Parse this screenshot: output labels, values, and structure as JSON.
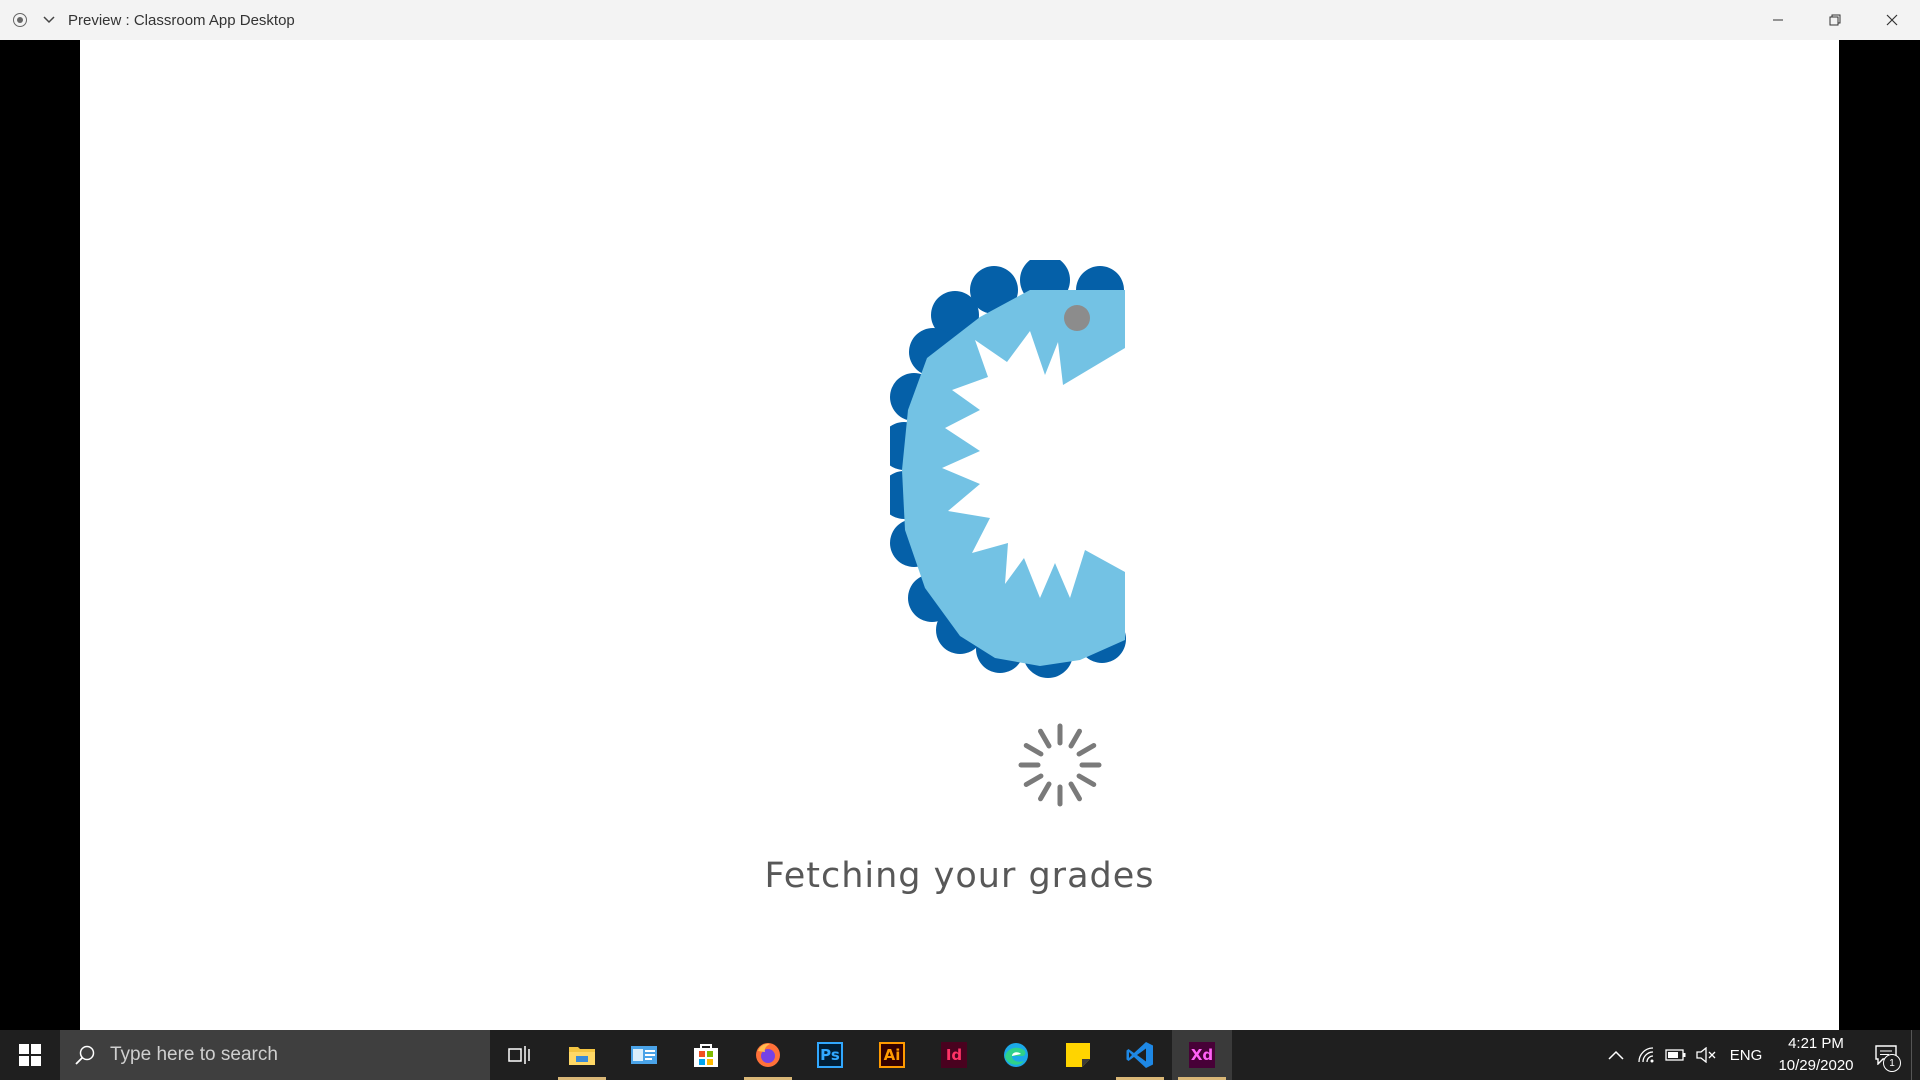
{
  "window": {
    "title": "Preview : Classroom App Desktop"
  },
  "content": {
    "status_text": "Fetching your grades"
  },
  "colors": {
    "logo_dark": "#0560a8",
    "logo_light": "#73c2e4",
    "logo_eye": "#8c8c8c",
    "spinner": "#7a7a7a",
    "taskbar": "#1f1f1f"
  },
  "taskbar": {
    "search_placeholder": "Type here to search",
    "apps": [
      {
        "name": "task-view",
        "running": false
      },
      {
        "name": "file-explorer",
        "running": true
      },
      {
        "name": "control-panel",
        "running": false
      },
      {
        "name": "microsoft-store",
        "running": false
      },
      {
        "name": "firefox",
        "running": true
      },
      {
        "name": "photoshop",
        "label": "Ps",
        "running": false
      },
      {
        "name": "illustrator",
        "label": "Ai",
        "running": false
      },
      {
        "name": "indesign",
        "label": "Id",
        "running": false
      },
      {
        "name": "edge",
        "running": false
      },
      {
        "name": "sticky-notes",
        "running": false
      },
      {
        "name": "vscode",
        "running": true
      },
      {
        "name": "adobe-xd",
        "label": "Xd",
        "running": true,
        "active": true
      }
    ],
    "tray": {
      "language": "ENG",
      "time": "4:21 PM",
      "date": "10/29/2020",
      "notification_count": "1"
    }
  }
}
